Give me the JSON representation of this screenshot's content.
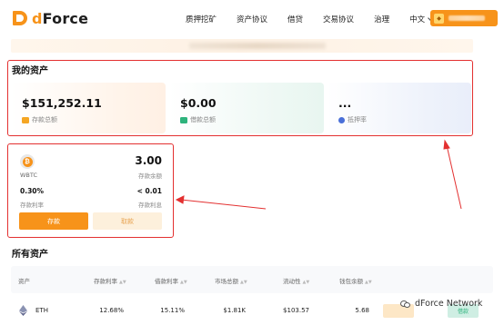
{
  "header": {
    "logo_text": "Force",
    "logo_prefix": "d",
    "nav": [
      "质押挖矿",
      "资产协议",
      "借贷",
      "交易协议",
      "治理"
    ],
    "language": "中文",
    "wallet_icon": "fox-wallet-icon"
  },
  "my_assets": {
    "title": "我的资产",
    "cards": [
      {
        "value": "$151,252.11",
        "label": "存款总额",
        "icon": "deposit-icon",
        "color": "#f5a623"
      },
      {
        "value": "$0.00",
        "label": "借款总额",
        "icon": "borrow-icon",
        "color": "#2db37c"
      },
      {
        "value": "...",
        "label": "抵押率",
        "icon": "collateral-icon",
        "color": "#4a6fd8"
      }
    ]
  },
  "operation": {
    "token": "WBTC",
    "token_icon": "bitcoin-icon",
    "balance": "3.00",
    "balance_label": "存款余额",
    "rate": "0.30%",
    "rate_label": "存款利率",
    "interest": "< 0.01",
    "interest_label": "存款利息",
    "deposit_button": "存款",
    "withdraw_button": "取款"
  },
  "all_assets": {
    "title": "所有资产",
    "columns": [
      "资产",
      "存款利率",
      "借款利率",
      "市场总额",
      "流动性",
      "钱包余额"
    ],
    "rows": [
      {
        "asset": "ETH",
        "deposit_rate": "12.68%",
        "borrow_rate": "15.11%",
        "market_total": "$1.81K",
        "liquidity": "$103.57",
        "wallet_balance": "5.68"
      }
    ],
    "row_action": "借款"
  },
  "watermark": "dForce Network",
  "colors": {
    "brand": "#f7931a",
    "annotation": "#e33030",
    "green": "#2db37c"
  }
}
